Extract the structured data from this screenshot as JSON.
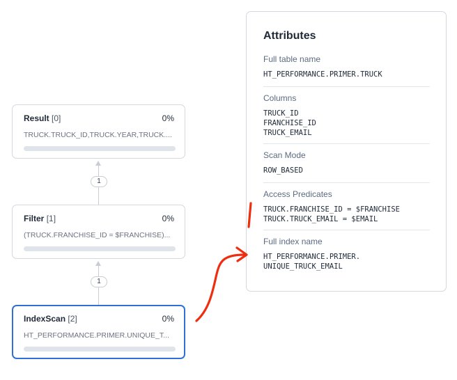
{
  "plan": {
    "nodes": [
      {
        "name": "Result",
        "index": "[0]",
        "percent": "0%",
        "description": "TRUCK.TRUCK_ID,TRUCK.YEAR,TRUCK....",
        "progress": 0
      },
      {
        "name": "Filter",
        "index": "[1]",
        "percent": "0%",
        "description": "(TRUCK.FRANCHISE_ID = $FRANCHISE)...",
        "progress": 0
      },
      {
        "name": "IndexScan",
        "index": "[2]",
        "percent": "0%",
        "description": "HT_PERFORMANCE.PRIMER.UNIQUE_T...",
        "progress": 0,
        "selected": true
      }
    ],
    "edges": [
      {
        "label": "1"
      },
      {
        "label": "1"
      }
    ]
  },
  "attributes": {
    "title": "Attributes",
    "sections": [
      {
        "label": "Full table name",
        "lines": [
          "HT_PERFORMANCE.PRIMER.TRUCK"
        ]
      },
      {
        "label": "Columns",
        "lines": [
          "TRUCK_ID",
          "FRANCHISE_ID",
          "TRUCK_EMAIL"
        ]
      },
      {
        "label": "Scan Mode",
        "lines": [
          "ROW_BASED"
        ]
      },
      {
        "label": "Access Predicates",
        "lines": [
          "TRUCK.FRANCHISE_ID = $FRANCHISE",
          "TRUCK.TRUCK_EMAIL = $EMAIL"
        ]
      },
      {
        "label": "Full index name",
        "lines": [
          "HT_PERFORMANCE.PRIMER.",
          "UNIQUE_TRUCK_EMAIL"
        ]
      }
    ]
  },
  "colors": {
    "selected_border": "#2f6fd6",
    "annotation": "#ef2d10"
  }
}
